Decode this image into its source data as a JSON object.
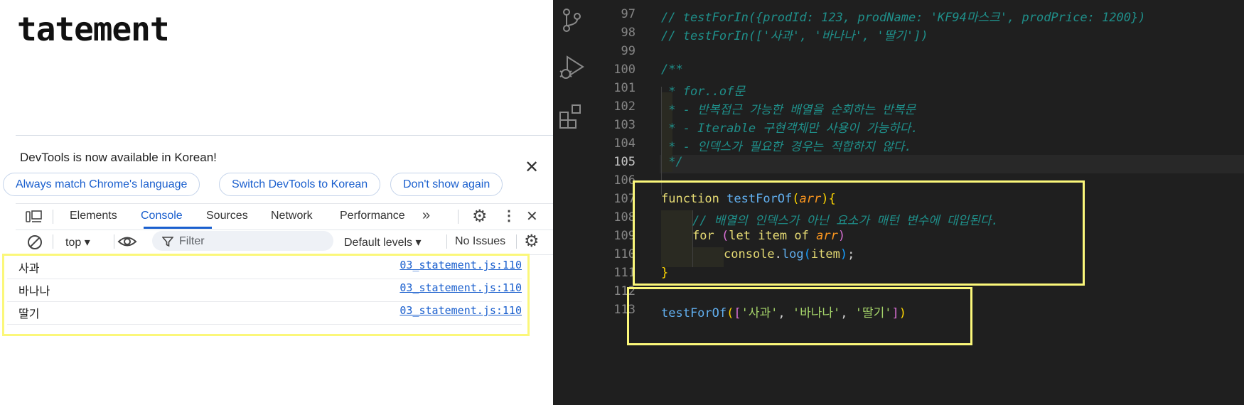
{
  "page": {
    "title": "tatement"
  },
  "devtools": {
    "lang_banner": {
      "message": "DevTools is now available in Korean!",
      "buttons": [
        "Always match Chrome's language",
        "Switch DevTools to Korean",
        "Don't show again"
      ]
    },
    "tabs": [
      "Elements",
      "Console",
      "Sources",
      "Network",
      "Performance"
    ],
    "active_tab": "Console",
    "filter_bar": {
      "context": "top",
      "filter_placeholder": "Filter",
      "levels": "Default levels",
      "issues": "No Issues"
    },
    "console_logs": [
      {
        "message": "사과",
        "source": "03_statement.js:110"
      },
      {
        "message": "바나나",
        "source": "03_statement.js:110"
      },
      {
        "message": "딸기",
        "source": "03_statement.js:110"
      }
    ]
  },
  "editor": {
    "current_line": "105",
    "line_numbers": [
      "97",
      "98",
      "99",
      "100",
      "101",
      "102",
      "103",
      "104",
      "105",
      "106",
      "107",
      "108",
      "109",
      "110",
      "111",
      "112",
      "113"
    ],
    "comments": {
      "l97": "// testForIn({prodId: 123, prodName: 'KF94마스크', prodPrice: 1200})",
      "l98": "// testForIn(['사과', '바나나', '딸기'])",
      "l100": "/**",
      "l101": " * for..of문",
      "l102": " * - 반복접근 가능한 배열을 순회하는 반복문",
      "l103": " * - Iterable 구현객체만 사용이 가능하다.",
      "l104": " * - 인덱스가 필요한 경우는 적합하지 않다.",
      "l105": " */",
      "l108": "// 배열의 인덱스가 아닌 요소가 매턴 변수에 대입된다."
    },
    "tokens": {
      "function_kw": "function",
      "fn_name": "testForOf",
      "param": "arr",
      "for_kw": "for",
      "let_kw": "let",
      "item_var": "item",
      "of_kw": "of",
      "console_obj": "console",
      "log_fn": "log",
      "str1": "'사과'",
      "str2": "'바나나'",
      "str3": "'딸기'"
    }
  }
}
